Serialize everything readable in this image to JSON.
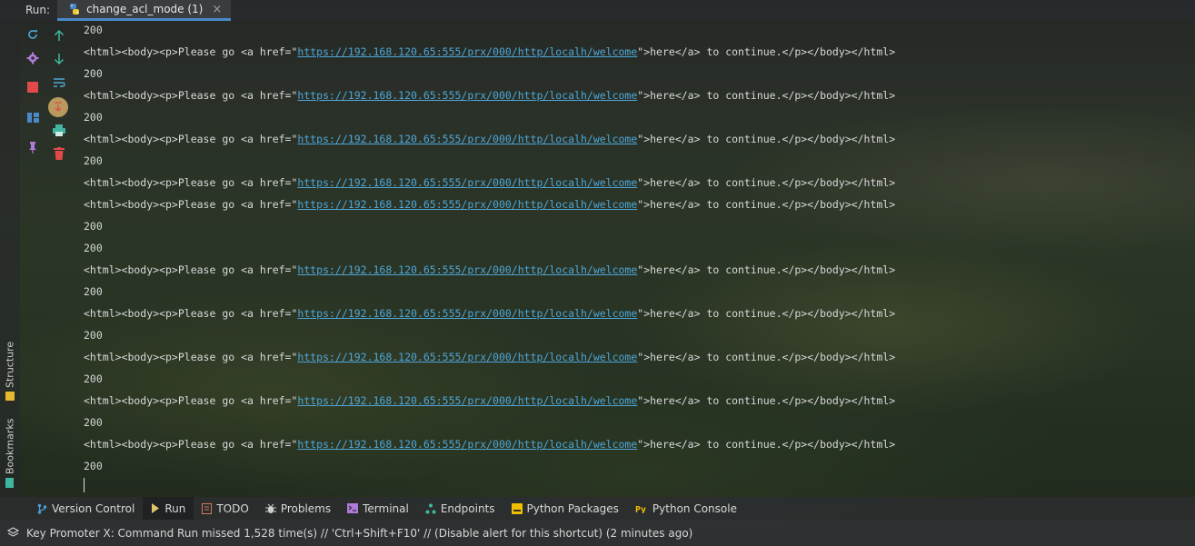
{
  "run_bar": {
    "label": "Run:",
    "tab_title": "change_acl_mode (1)",
    "close_glyph": "×"
  },
  "side_labels": {
    "structure": "Structure",
    "bookmarks": "Bookmarks"
  },
  "console": {
    "lines": [
      {
        "type": "status",
        "text": "200"
      },
      {
        "type": "html",
        "pre": "<html><body><p>Please go <a href=\"",
        "url": "https://192.168.120.65:555/prx/000/http/localh/welcome",
        "post": "\">here</a> to continue.</p></body></html>"
      },
      {
        "type": "status",
        "text": "200"
      },
      {
        "type": "html",
        "pre": "<html><body><p>Please go <a href=\"",
        "url": "https://192.168.120.65:555/prx/000/http/localh/welcome",
        "post": "\">here</a> to continue.</p></body></html>"
      },
      {
        "type": "status",
        "text": "200"
      },
      {
        "type": "html",
        "pre": "<html><body><p>Please go <a href=\"",
        "url": "https://192.168.120.65:555/prx/000/http/localh/welcome",
        "post": "\">here</a> to continue.</p></body></html>"
      },
      {
        "type": "status",
        "text": "200"
      },
      {
        "type": "html",
        "pre": "<html><body><p>Please go <a href=\"",
        "url": "https://192.168.120.65:555/prx/000/http/localh/welcome",
        "post": "\">here</a> to continue.</p></body></html>"
      },
      {
        "type": "html",
        "pre": "<html><body><p>Please go <a href=\"",
        "url": "https://192.168.120.65:555/prx/000/http/localh/welcome",
        "post": "\">here</a> to continue.</p></body></html>"
      },
      {
        "type": "status",
        "text": "200"
      },
      {
        "type": "status",
        "text": "200"
      },
      {
        "type": "html",
        "pre": "<html><body><p>Please go <a href=\"",
        "url": "https://192.168.120.65:555/prx/000/http/localh/welcome",
        "post": "\">here</a> to continue.</p></body></html>"
      },
      {
        "type": "status",
        "text": "200"
      },
      {
        "type": "html",
        "pre": "<html><body><p>Please go <a href=\"",
        "url": "https://192.168.120.65:555/prx/000/http/localh/welcome",
        "post": "\">here</a> to continue.</p></body></html>"
      },
      {
        "type": "status",
        "text": "200"
      },
      {
        "type": "html",
        "pre": "<html><body><p>Please go <a href=\"",
        "url": "https://192.168.120.65:555/prx/000/http/localh/welcome",
        "post": "\">here</a> to continue.</p></body></html>"
      },
      {
        "type": "status",
        "text": "200"
      },
      {
        "type": "html",
        "pre": "<html><body><p>Please go <a href=\"",
        "url": "https://192.168.120.65:555/prx/000/http/localh/welcome",
        "post": "\">here</a> to continue.</p></body></html>"
      },
      {
        "type": "status",
        "text": "200"
      },
      {
        "type": "html",
        "pre": "<html><body><p>Please go <a href=\"",
        "url": "https://192.168.120.65:555/prx/000/http/localh/welcome",
        "post": "\">here</a> to continue.</p></body></html>"
      },
      {
        "type": "status",
        "text": "200"
      }
    ]
  },
  "tool_icons": {
    "rerun": "rerun-icon",
    "settings": "gear-icon",
    "stop": "stop-icon",
    "layout": "layout-icon",
    "pin": "pin-icon",
    "up": "arrow-up-icon",
    "down": "arrow-down-icon",
    "wrap": "soft-wrap-icon",
    "scroll_end": "scroll-to-end-icon",
    "print": "print-icon",
    "clear": "trash-icon"
  },
  "bottom_tabs": [
    {
      "label": "Version Control",
      "icon": "branch-icon",
      "color": "#4a9fd8"
    },
    {
      "label": "Run",
      "icon": "run-icon",
      "color": "#e0c46c",
      "active": true
    },
    {
      "label": "TODO",
      "icon": "todo-icon",
      "color": "#d07a5a"
    },
    {
      "label": "Problems",
      "icon": "bug-icon",
      "color": "#cfcfcf"
    },
    {
      "label": "Terminal",
      "icon": "terminal-icon",
      "color": "#b07ad8"
    },
    {
      "label": "Endpoints",
      "icon": "endpoints-icon",
      "color": "#3fb7a0"
    },
    {
      "label": "Python Packages",
      "icon": "package-icon",
      "color": "#f0c000"
    },
    {
      "label": "Python Console",
      "icon": "python-console-icon",
      "color": "#f0c000"
    }
  ],
  "status_bar": {
    "message": "Key Promoter X: Command Run missed 1,528 time(s) // 'Ctrl+Shift+F10' // (Disable alert for this shortcut) (2 minutes ago)"
  }
}
